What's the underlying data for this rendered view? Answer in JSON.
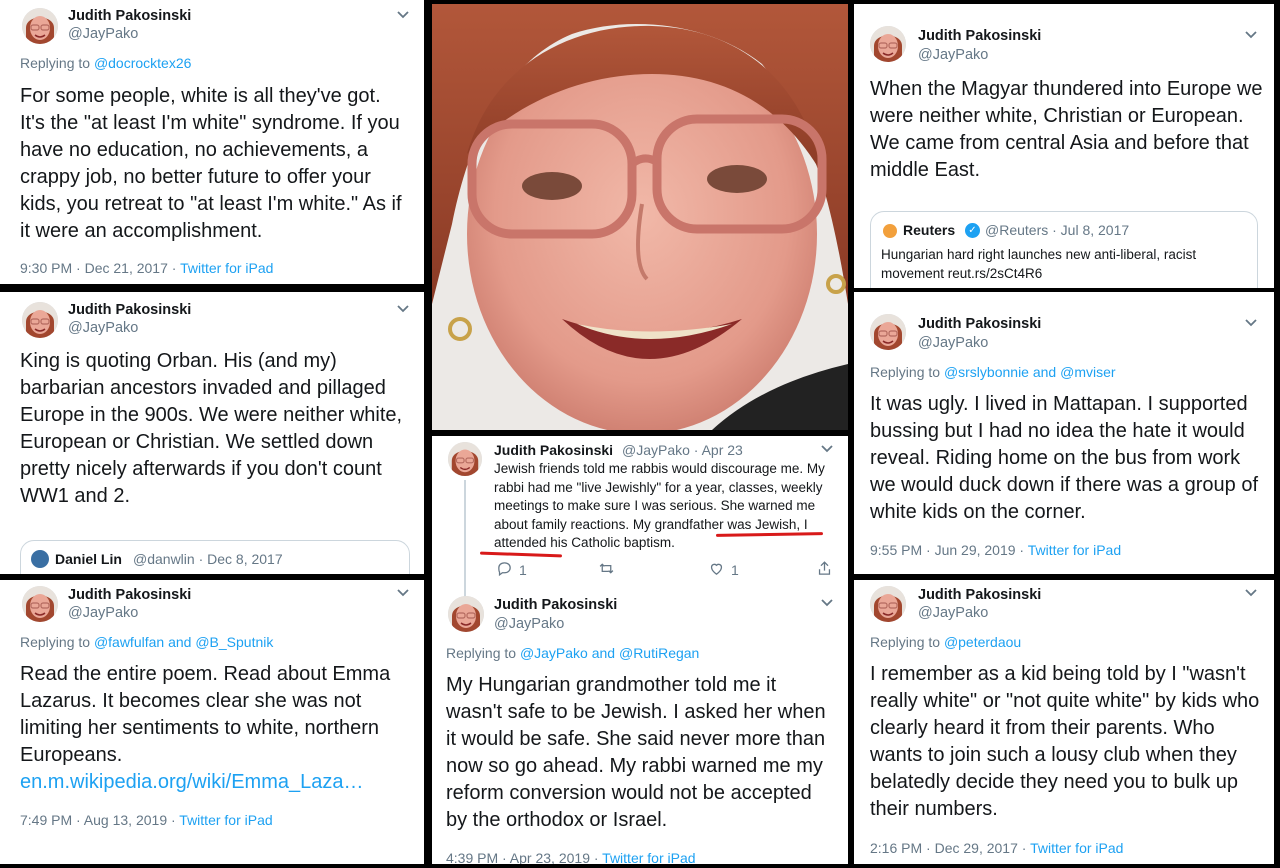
{
  "author": {
    "name": "Judith Pakosinski",
    "handle": "@JayPako"
  },
  "colors": {
    "link": "#1da1f2",
    "muted": "#657786",
    "text": "#14171a",
    "underline": "#d81a1a"
  },
  "tweet1": {
    "reply_prefix": "Replying to",
    "reply_to": "@docrocktex26",
    "text": "For some people, white is all they've got. It's the \"at least I'm white\" syndrome. If you have no education, no achievements, a crappy job, no better future to offer your kids, you retreat to \"at least I'm white.\" As if  it were an accomplishment.",
    "timestamp": "9:30 PM · Dec 21, 2017 · ",
    "source": "Twitter for iPad"
  },
  "tweet2": {
    "text": "King is quoting Orban. His (and my) barbarian ancestors invaded and pillaged Europe in the 900s. We were neither white, European or Christian. We settled down pretty nicely afterwards if you don't count WW1 and 2.",
    "quote_name": "Daniel Lin",
    "quote_handle": "@danwlin · Dec 8, 2017"
  },
  "tweet3": {
    "reply_prefix": "Replying to",
    "reply_to": "@fawfulfan and @B_Sputnik",
    "text": "Read the entire poem. Read about Emma Lazarus. It becomes clear she was not limiting her sentiments to white, northern Europeans.",
    "link": "en.m.wikipedia.org/wiki/Emma_Laza…",
    "timestamp": "7:49 PM · Aug 13, 2019 · ",
    "source": "Twitter for iPad"
  },
  "tweet4": {
    "text": "When the Magyar thundered into Europe we were neither white, Christian or European. We came from central Asia and before that middle East.",
    "quote_name": "Reuters",
    "quote_handle": "@Reuters · Jul 8, 2017",
    "quote_text": "Hungarian hard right launches new anti-liberal, racist movement reut.rs/2sCt4R6"
  },
  "tweet5": {
    "reply_prefix": "Replying to",
    "reply_to": "@srslybonnie and @mviser",
    "text": "It was ugly. I lived in Mattapan. I supported bussing but I had no idea the hate it would reveal. Riding home on the bus from work we would duck down if there was a group of white kids on the corner.",
    "timestamp": "9:55 PM · Jun 29, 2019 · ",
    "source": "Twitter for iPad"
  },
  "tweet6": {
    "reply_prefix": "Replying to",
    "reply_to": "@peterdaou",
    "text": "I remember as a kid being told by I \"wasn't really white\" or \"not quite white\" by kids who clearly heard it from their parents. Who wants to join such a lousy club when they belatedly decide they need you to bulk up their numbers.",
    "timestamp": "2:16 PM · Dec 29, 2017 · ",
    "source": "Twitter for iPad"
  },
  "tweet7": {
    "handle_date": "@JayPako · Apr 23",
    "text": "Jewish friends told me rabbis would discourage me. My rabbi had me \"live Jewishly\" for a year, classes, weekly meetings to make sure I was serious. She warned me about family reactions. My grandfather was Jewish, I attended his Catholic baptism.",
    "reply_count": "1",
    "like_count": "1"
  },
  "tweet8": {
    "reply_prefix": "Replying to",
    "reply_to": "@JayPako and @RutiRegan",
    "text": "My Hungarian grandmother told me it wasn't safe to be Jewish. I asked her when it would be safe. She said never more than now so go ahead. My rabbi warned me my reform conversion would not be accepted by the orthodox or Israel.",
    "timestamp": "4:39 PM · Apr 23, 2019 · ",
    "source": "Twitter for iPad"
  },
  "icons": [
    "chevron-down-icon",
    "avatar",
    "verified-icon",
    "reply-icon",
    "retweet-icon",
    "like-icon",
    "share-icon"
  ]
}
